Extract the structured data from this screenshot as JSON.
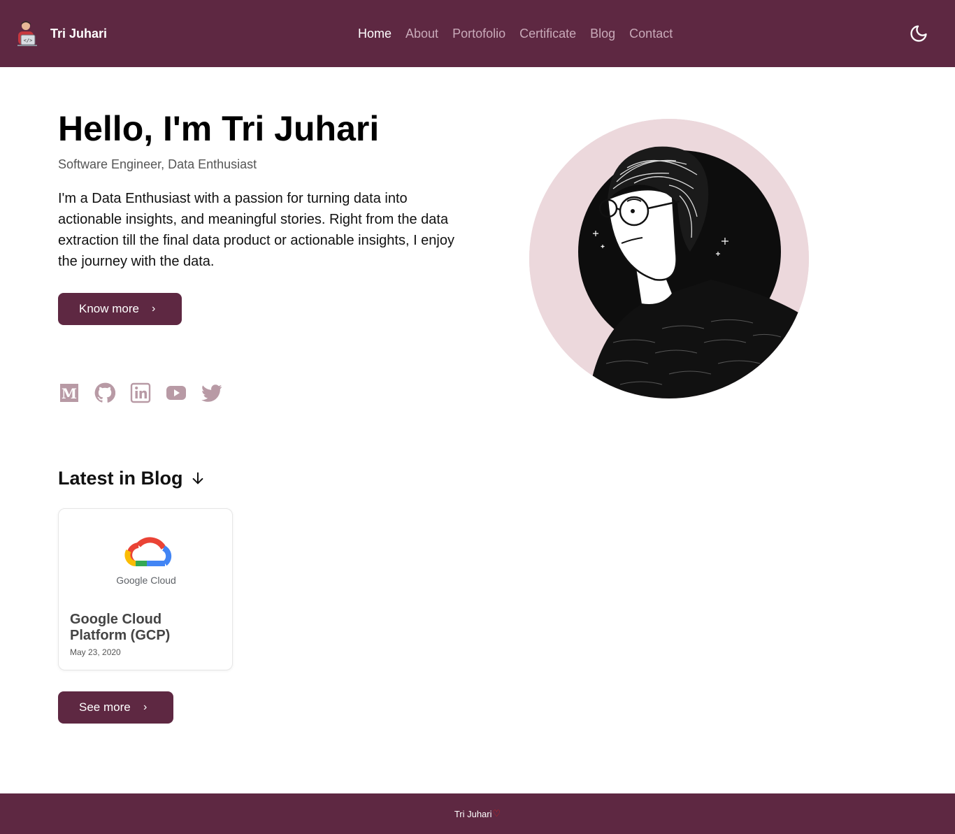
{
  "colors": {
    "brand": "#5e2842",
    "nav_inactive": "#c9aab9",
    "social_icon": "#b89aa5",
    "portrait_bg": "#ecd8dc",
    "heart": "#e0201c"
  },
  "navbar": {
    "brand_name": "Tri Juhari",
    "brand_icon": "developer-avatar-icon",
    "links": [
      {
        "label": "Home",
        "active": true
      },
      {
        "label": "About",
        "active": false
      },
      {
        "label": "Portofolio",
        "active": false
      },
      {
        "label": "Certificate",
        "active": false
      },
      {
        "label": "Blog",
        "active": false
      },
      {
        "label": "Contact",
        "active": false
      }
    ],
    "theme_toggle_icon": "moon-icon"
  },
  "hero": {
    "title": "Hello, I'm Tri Juhari",
    "subtitle": "Software Engineer, Data Enthusiast",
    "description": "I'm a Data Enthusiast with a passion for turning data into actionable insights, and meaningful stories. Right from the data extraction till the final data product or actionable insights, I enjoy the journey with the data.",
    "cta_label": "Know more",
    "cta_icon": "chevron-right-icon",
    "portrait_icon": "portrait-illustration"
  },
  "socials": [
    {
      "name": "medium-icon"
    },
    {
      "name": "github-icon"
    },
    {
      "name": "linkedin-icon"
    },
    {
      "name": "youtube-icon"
    },
    {
      "name": "twitter-icon"
    }
  ],
  "blog": {
    "section_title": "Latest in Blog",
    "section_icon": "arrow-down-icon",
    "posts": [
      {
        "title": "Google Cloud Platform (GCP)",
        "date": "May 23, 2020",
        "image_icon": "google-cloud-logo",
        "image_text": "Google Cloud"
      }
    ],
    "see_more_label": "See more"
  },
  "footer": {
    "text": "Tri Juhari",
    "icon": "heart-icon"
  }
}
